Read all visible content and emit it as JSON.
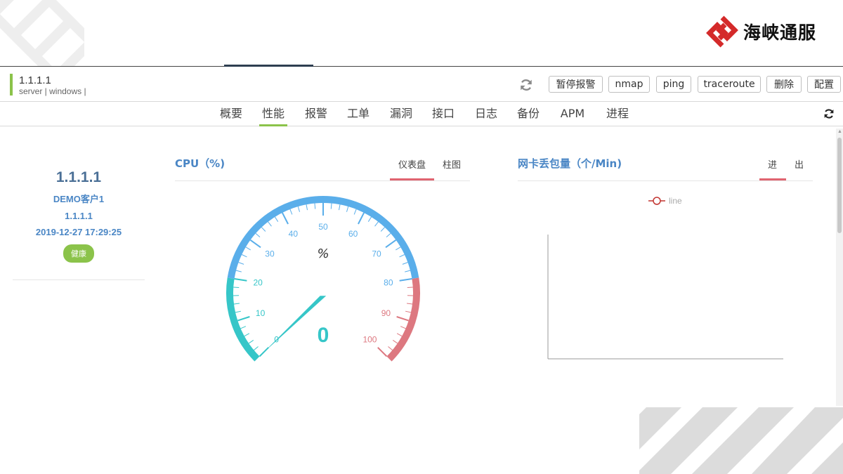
{
  "brand": {
    "name": "海峡通服"
  },
  "device": {
    "ip": "1.1.1.1",
    "meta": "server |  windows |"
  },
  "actions": [
    {
      "label": "暂停报警"
    },
    {
      "label": "nmap"
    },
    {
      "label": "ping"
    },
    {
      "label": "traceroute"
    },
    {
      "label": "删除"
    },
    {
      "label": "配置"
    }
  ],
  "nav": {
    "tabs": [
      {
        "label": "概要"
      },
      {
        "label": "性能",
        "active": true
      },
      {
        "label": "报警"
      },
      {
        "label": "工单"
      },
      {
        "label": "漏洞"
      },
      {
        "label": "接口"
      },
      {
        "label": "日志"
      },
      {
        "label": "备份"
      },
      {
        "label": "APM"
      },
      {
        "label": "进程"
      }
    ]
  },
  "info": {
    "ip": "1.1.1.1",
    "customer": "DEMO客户1",
    "ip2": "1.1.1.1",
    "time": "2019-12-27 17:29:25",
    "status": "健康"
  },
  "cpu_panel": {
    "title": "CPU（%)",
    "tabs": [
      "仪表盘",
      "柱图"
    ],
    "active_tab": "仪表盘"
  },
  "net_panel": {
    "title": "网卡丢包量（个/Min)",
    "tabs": [
      "进",
      "出"
    ],
    "active_tab": "进"
  },
  "colors": {
    "accent_green": "#8bc34a",
    "title_blue": "#4a86c5",
    "gauge_low": "#36c6c8",
    "gauge_mid": "#5aaeea",
    "gauge_high": "#dd7880",
    "tab_underline": "#e06470"
  },
  "chart_data": [
    {
      "type": "gauge",
      "min": 0,
      "max": 100,
      "value": 0,
      "unit": "%",
      "tick_labels": [
        "0",
        "10",
        "20",
        "30",
        "40",
        "50",
        "60",
        "70",
        "80",
        "90",
        "100"
      ],
      "bands": [
        {
          "from": 0,
          "to": 20,
          "color": "#36c6c8"
        },
        {
          "from": 20,
          "to": 80,
          "color": "#5aaeea"
        },
        {
          "from": 80,
          "to": 100,
          "color": "#dd7880"
        }
      ],
      "value_label": "0"
    },
    {
      "type": "line",
      "legend": [
        "line"
      ],
      "series": [
        {
          "name": "line",
          "values": []
        }
      ]
    }
  ]
}
